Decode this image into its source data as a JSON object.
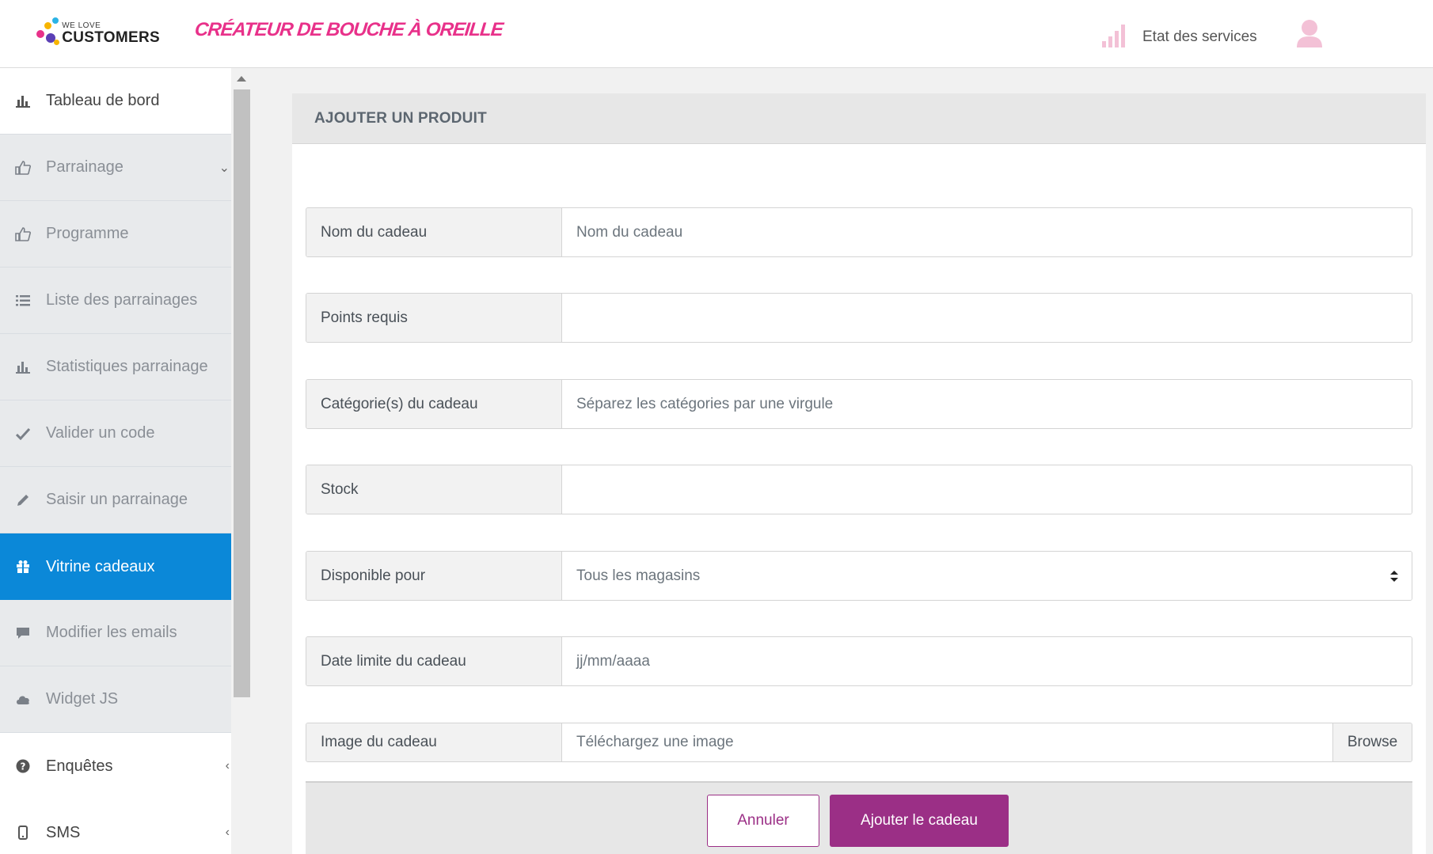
{
  "header": {
    "logo_small": "WE LOVE",
    "logo_big": "CUSTOMERS",
    "tagline": "CRÉATEUR DE BOUCHE À OREILLE",
    "status_label": "Etat des services",
    "status_icon": "signal-bars-icon",
    "avatar_icon": "user-icon"
  },
  "sidebar": {
    "items": [
      {
        "label": "Tableau de bord",
        "icon": "bar-chart-icon"
      },
      {
        "label": "Parrainage",
        "icon": "thumbs-up-icon"
      },
      {
        "label": "Programme",
        "icon": "thumbs-up-icon"
      },
      {
        "label": "Liste des parrainages",
        "icon": "list-icon"
      },
      {
        "label": "Statistiques parrainage",
        "icon": "bar-chart-icon"
      },
      {
        "label": "Valider un code",
        "icon": "check-icon"
      },
      {
        "label": "Saisir un parrainage",
        "icon": "pencil-icon"
      },
      {
        "label": "Vitrine cadeaux",
        "icon": "gift-icon"
      },
      {
        "label": "Modifier les emails",
        "icon": "comment-icon"
      },
      {
        "label": "Widget JS",
        "icon": "cloud-icon"
      },
      {
        "label": "Enquêtes",
        "icon": "question-circle-icon"
      },
      {
        "label": "SMS",
        "icon": "mobile-icon"
      }
    ],
    "active": "Vitrine cadeaux"
  },
  "panel": {
    "title": "AJOUTER UN PRODUIT",
    "fields": [
      {
        "label": "Nom du cadeau",
        "placeholder": "Nom du cadeau",
        "value": ""
      },
      {
        "label": "Points requis",
        "placeholder": "",
        "value": ""
      },
      {
        "label": "Catégorie(s) du cadeau",
        "placeholder": "Séparez les catégories par une virgule",
        "value": ""
      },
      {
        "label": "Stock",
        "placeholder": "",
        "value": ""
      },
      {
        "label": "Disponible pour",
        "selected": "Tous les magasins"
      },
      {
        "label": "Date limite du cadeau",
        "placeholder": "jj/mm/aaaa",
        "value": ""
      },
      {
        "label": "Image du cadeau",
        "placeholder": "Téléchargez une image",
        "browse": "Browse"
      }
    ],
    "buttons": {
      "cancel": "Annuler",
      "submit": "Ajouter le cadeau"
    }
  },
  "colors": {
    "active_nav": "#0b88d8",
    "primary_button": "#9b2f86",
    "tagline": "#e8318a"
  }
}
